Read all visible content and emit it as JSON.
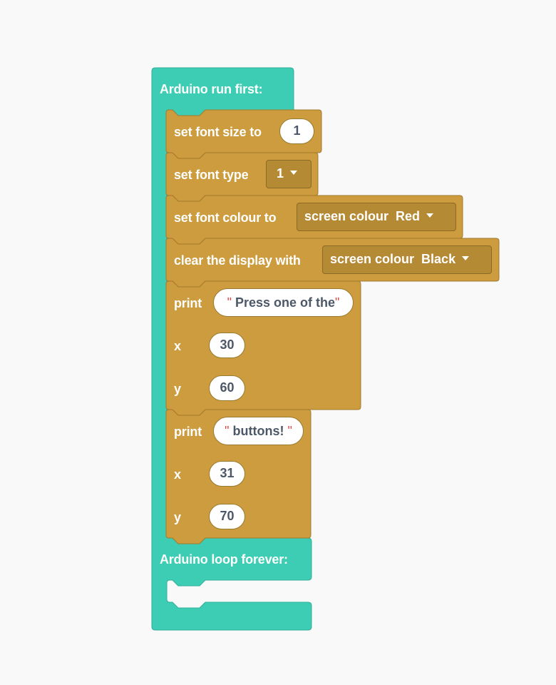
{
  "colors": {
    "background": "#f9f9f9",
    "hat_block": "#3dcdb4",
    "action_block": "#cc9c3e",
    "dropdown_field": "#b58a35",
    "input_field": "#ffffff",
    "input_text": "#4c5868",
    "string_quote": "#e04a4a"
  },
  "setup_block": {
    "title": "Arduino run first:",
    "blocks": [
      {
        "label": "set font size to",
        "value": "1"
      },
      {
        "label": "set font type",
        "dropdown": "1"
      },
      {
        "label": "set font colour to",
        "dropdown_prefix": "screen colour",
        "dropdown_value": "Red"
      },
      {
        "label": "clear the display with",
        "dropdown_prefix": "screen colour",
        "dropdown_value": "Black"
      },
      {
        "label": "print",
        "text": "Press one of the",
        "x_label": "x",
        "x": "30",
        "y_label": "y",
        "y": "60"
      },
      {
        "label": "print",
        "text": "buttons!",
        "x_label": "x",
        "x": "31",
        "y_label": "y",
        "y": "70"
      }
    ]
  },
  "loop_block": {
    "title": "Arduino loop forever:"
  },
  "quote_char": "\""
}
